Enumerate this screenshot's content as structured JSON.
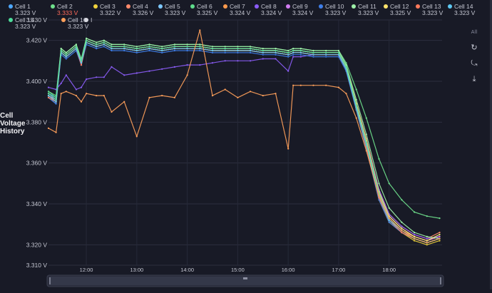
{
  "side_title": [
    "Cell",
    "Voltage",
    "History"
  ],
  "toolbar": {
    "collapse_label": "All",
    "icons": [
      "refresh-icon",
      "zoom-reset-icon",
      "download-icon"
    ]
  },
  "legend_items": [
    {
      "name": "Cell 1",
      "value": "3.323 V",
      "color": "#4ea8ff"
    },
    {
      "name": "Cell 2",
      "value": "3.333 V",
      "color": "#6fe08c",
      "value_color": "#ff6b5a"
    },
    {
      "name": "Cell 3",
      "value": "3.322 V",
      "color": "#f0d23c"
    },
    {
      "name": "Cell 4",
      "value": "3.326 V",
      "color": "#ff8a6b"
    },
    {
      "name": "Cell 5",
      "value": "3.323 V",
      "color": "#7ec8ff"
    },
    {
      "name": "Cell 6",
      "value": "3.325 V",
      "color": "#5fdc8c"
    },
    {
      "name": "Cell 7",
      "value": "3.324 V",
      "color": "#ff9a4d"
    },
    {
      "name": "Cell 8",
      "value": "3.324 V",
      "color": "#8b5cf6"
    },
    {
      "name": "Cell 9",
      "value": "3.324 V",
      "color": "#d07cf0"
    },
    {
      "name": "Cell 10",
      "value": "3.323 V",
      "color": "#3f7ee8"
    },
    {
      "name": "Cell 11",
      "value": "3.323 V",
      "color": "#9ef0a8"
    },
    {
      "name": "Cell 12",
      "value": "3.325 V",
      "color": "#ffe36b"
    },
    {
      "name": "Cell 13",
      "value": "3.323 V",
      "color": "#ff7a5c"
    },
    {
      "name": "Cell 14",
      "value": "3.323 V",
      "color": "#5ec8f2"
    },
    {
      "name": "Cell 15",
      "value": "3.323 V",
      "color": "#4ddc9a"
    },
    {
      "name": "Cell 16",
      "value": "3.323 V",
      "color": "#ff9f5a"
    },
    {
      "name": "I",
      "value": "",
      "color": "#d8d8e0"
    }
  ],
  "chart_data": {
    "type": "line",
    "ylabel": "",
    "ylim": [
      3.31,
      3.43
    ],
    "y_ticks": [
      "3.430 V",
      "3.420 V",
      "3.400 V",
      "3.380 V",
      "3.360 V",
      "3.340 V",
      "3.320 V",
      "3.310 V"
    ],
    "x_ticks": [
      "12:00",
      "13:00",
      "14:00",
      "15:00",
      "16:00",
      "17:00",
      "18:00"
    ],
    "x_unit": "hours (decimal)",
    "xlim": [
      11.25,
      19.05
    ],
    "x": [
      11.25,
      11.4,
      11.5,
      11.6,
      11.8,
      11.9,
      12.0,
      12.2,
      12.35,
      12.5,
      12.75,
      13.0,
      13.25,
      13.5,
      13.75,
      14.0,
      14.25,
      14.5,
      14.75,
      15.0,
      15.25,
      15.5,
      15.75,
      16.0,
      16.1,
      16.25,
      16.5,
      16.75,
      17.0,
      17.15,
      17.35,
      17.55,
      17.8,
      18.0,
      18.25,
      18.5,
      18.75,
      19.0
    ],
    "series": [
      {
        "name": "Cell 1",
        "color": "#4ea8ff",
        "values": [
          3.394,
          3.392,
          3.415,
          3.413,
          3.417,
          3.409,
          3.42,
          3.418,
          3.419,
          3.417,
          3.417,
          3.416,
          3.417,
          3.416,
          3.417,
          3.417,
          3.417,
          3.416,
          3.416,
          3.416,
          3.416,
          3.415,
          3.415,
          3.414,
          3.415,
          3.415,
          3.414,
          3.414,
          3.414,
          3.407,
          3.388,
          3.37,
          3.345,
          3.333,
          3.327,
          3.323,
          3.321,
          3.323
        ]
      },
      {
        "name": "Cell 2",
        "color": "#6fe08c",
        "values": [
          3.395,
          3.393,
          3.416,
          3.414,
          3.418,
          3.411,
          3.421,
          3.419,
          3.42,
          3.418,
          3.418,
          3.417,
          3.418,
          3.417,
          3.418,
          3.418,
          3.418,
          3.417,
          3.417,
          3.417,
          3.417,
          3.416,
          3.416,
          3.415,
          3.416,
          3.416,
          3.415,
          3.415,
          3.415,
          3.409,
          3.396,
          3.382,
          3.362,
          3.35,
          3.342,
          3.336,
          3.334,
          3.333
        ]
      },
      {
        "name": "Cell 3",
        "color": "#f0d23c",
        "values": [
          3.393,
          3.39,
          3.414,
          3.412,
          3.416,
          3.408,
          3.419,
          3.417,
          3.418,
          3.416,
          3.416,
          3.415,
          3.416,
          3.415,
          3.416,
          3.416,
          3.416,
          3.415,
          3.415,
          3.415,
          3.415,
          3.414,
          3.414,
          3.413,
          3.414,
          3.414,
          3.413,
          3.413,
          3.413,
          3.406,
          3.386,
          3.367,
          3.342,
          3.331,
          3.326,
          3.322,
          3.32,
          3.322
        ]
      },
      {
        "name": "Cell 4",
        "color": "#ff8a6b",
        "values": [
          3.394,
          3.391,
          3.415,
          3.413,
          3.417,
          3.41,
          3.42,
          3.418,
          3.419,
          3.417,
          3.417,
          3.416,
          3.417,
          3.416,
          3.417,
          3.417,
          3.417,
          3.416,
          3.416,
          3.416,
          3.416,
          3.415,
          3.415,
          3.414,
          3.415,
          3.415,
          3.414,
          3.414,
          3.414,
          3.407,
          3.389,
          3.372,
          3.347,
          3.335,
          3.329,
          3.325,
          3.323,
          3.326
        ]
      },
      {
        "name": "Cell 5",
        "color": "#7ec8ff",
        "values": [
          3.392,
          3.389,
          3.414,
          3.412,
          3.416,
          3.408,
          3.419,
          3.417,
          3.418,
          3.416,
          3.416,
          3.415,
          3.416,
          3.415,
          3.416,
          3.416,
          3.416,
          3.415,
          3.415,
          3.415,
          3.415,
          3.414,
          3.414,
          3.413,
          3.414,
          3.414,
          3.413,
          3.413,
          3.413,
          3.406,
          3.387,
          3.368,
          3.343,
          3.332,
          3.326,
          3.323,
          3.321,
          3.323
        ]
      },
      {
        "name": "Cell 6",
        "color": "#5fdc8c",
        "values": [
          3.395,
          3.392,
          3.415,
          3.413,
          3.417,
          3.41,
          3.42,
          3.418,
          3.419,
          3.417,
          3.417,
          3.416,
          3.417,
          3.416,
          3.417,
          3.417,
          3.417,
          3.416,
          3.416,
          3.416,
          3.416,
          3.415,
          3.415,
          3.414,
          3.415,
          3.415,
          3.414,
          3.414,
          3.414,
          3.407,
          3.389,
          3.371,
          3.346,
          3.334,
          3.328,
          3.324,
          3.322,
          3.325
        ]
      },
      {
        "name": "Cell 7",
        "color": "#ff9a4d",
        "values": [
          3.393,
          3.39,
          3.414,
          3.412,
          3.416,
          3.409,
          3.419,
          3.417,
          3.418,
          3.416,
          3.416,
          3.415,
          3.416,
          3.415,
          3.416,
          3.416,
          3.416,
          3.415,
          3.415,
          3.415,
          3.415,
          3.414,
          3.414,
          3.413,
          3.414,
          3.414,
          3.413,
          3.413,
          3.413,
          3.406,
          3.388,
          3.37,
          3.345,
          3.333,
          3.327,
          3.324,
          3.322,
          3.324
        ]
      },
      {
        "name": "Cell 8",
        "color": "#8b5cf6",
        "values": [
          3.397,
          3.396,
          3.399,
          3.403,
          3.396,
          3.397,
          3.401,
          3.402,
          3.402,
          3.407,
          3.403,
          3.404,
          3.405,
          3.406,
          3.407,
          3.408,
          3.408,
          3.409,
          3.41,
          3.41,
          3.41,
          3.411,
          3.411,
          3.405,
          3.412,
          3.412,
          3.413,
          3.413,
          3.413,
          3.406,
          3.389,
          3.371,
          3.347,
          3.335,
          3.329,
          3.325,
          3.323,
          3.324
        ]
      },
      {
        "name": "Cell 9",
        "color": "#d07cf0",
        "values": [
          3.393,
          3.391,
          3.415,
          3.413,
          3.417,
          3.41,
          3.42,
          3.418,
          3.419,
          3.417,
          3.417,
          3.416,
          3.417,
          3.416,
          3.417,
          3.417,
          3.417,
          3.416,
          3.416,
          3.416,
          3.416,
          3.415,
          3.415,
          3.414,
          3.415,
          3.415,
          3.414,
          3.414,
          3.414,
          3.407,
          3.388,
          3.37,
          3.345,
          3.334,
          3.328,
          3.324,
          3.322,
          3.324
        ]
      },
      {
        "name": "Cell 10",
        "color": "#3f7ee8",
        "values": [
          3.392,
          3.389,
          3.413,
          3.411,
          3.415,
          3.408,
          3.418,
          3.416,
          3.417,
          3.415,
          3.415,
          3.414,
          3.415,
          3.414,
          3.415,
          3.415,
          3.415,
          3.414,
          3.414,
          3.414,
          3.414,
          3.413,
          3.413,
          3.412,
          3.413,
          3.413,
          3.412,
          3.412,
          3.412,
          3.405,
          3.386,
          3.367,
          3.342,
          3.331,
          3.326,
          3.323,
          3.321,
          3.323
        ]
      },
      {
        "name": "Cell 11",
        "color": "#9ef0a8",
        "values": [
          3.394,
          3.391,
          3.416,
          3.414,
          3.418,
          3.41,
          3.421,
          3.419,
          3.42,
          3.418,
          3.418,
          3.417,
          3.418,
          3.417,
          3.418,
          3.418,
          3.418,
          3.417,
          3.417,
          3.417,
          3.417,
          3.416,
          3.416,
          3.415,
          3.416,
          3.416,
          3.415,
          3.415,
          3.415,
          3.408,
          3.391,
          3.374,
          3.35,
          3.338,
          3.331,
          3.326,
          3.324,
          3.323
        ]
      },
      {
        "name": "Cell 12",
        "color": "#ffe36b",
        "values": [
          3.393,
          3.39,
          3.415,
          3.413,
          3.417,
          3.409,
          3.42,
          3.418,
          3.419,
          3.417,
          3.417,
          3.416,
          3.417,
          3.416,
          3.417,
          3.417,
          3.417,
          3.416,
          3.416,
          3.416,
          3.416,
          3.415,
          3.415,
          3.414,
          3.415,
          3.415,
          3.414,
          3.414,
          3.414,
          3.407,
          3.389,
          3.371,
          3.346,
          3.334,
          3.328,
          3.324,
          3.322,
          3.325
        ]
      },
      {
        "name": "Cell 13",
        "color": "#ff7a5c",
        "values": [
          3.392,
          3.39,
          3.414,
          3.412,
          3.416,
          3.408,
          3.419,
          3.417,
          3.418,
          3.416,
          3.416,
          3.415,
          3.416,
          3.415,
          3.416,
          3.416,
          3.416,
          3.415,
          3.415,
          3.415,
          3.415,
          3.414,
          3.414,
          3.413,
          3.414,
          3.414,
          3.413,
          3.413,
          3.413,
          3.406,
          3.387,
          3.368,
          3.343,
          3.332,
          3.326,
          3.323,
          3.321,
          3.323
        ]
      },
      {
        "name": "Cell 14",
        "color": "#5ec8f2",
        "values": [
          3.393,
          3.39,
          3.414,
          3.412,
          3.416,
          3.409,
          3.419,
          3.417,
          3.418,
          3.416,
          3.416,
          3.415,
          3.416,
          3.415,
          3.416,
          3.416,
          3.416,
          3.415,
          3.415,
          3.415,
          3.415,
          3.414,
          3.414,
          3.413,
          3.414,
          3.414,
          3.413,
          3.413,
          3.413,
          3.406,
          3.387,
          3.369,
          3.344,
          3.332,
          3.327,
          3.323,
          3.321,
          3.323
        ]
      },
      {
        "name": "Cell 15",
        "color": "#4ddc9a",
        "values": [
          3.394,
          3.391,
          3.415,
          3.413,
          3.417,
          3.41,
          3.42,
          3.418,
          3.419,
          3.417,
          3.417,
          3.416,
          3.417,
          3.416,
          3.417,
          3.417,
          3.417,
          3.416,
          3.416,
          3.416,
          3.416,
          3.415,
          3.415,
          3.414,
          3.415,
          3.415,
          3.414,
          3.414,
          3.414,
          3.407,
          3.388,
          3.37,
          3.345,
          3.333,
          3.327,
          3.323,
          3.321,
          3.323
        ]
      },
      {
        "name": "Cell 16",
        "color": "#ff9f5a",
        "values": [
          3.377,
          3.375,
          3.394,
          3.395,
          3.393,
          3.39,
          3.394,
          3.393,
          3.393,
          3.385,
          3.39,
          3.373,
          3.392,
          3.393,
          3.392,
          3.403,
          3.425,
          3.393,
          3.396,
          3.392,
          3.395,
          3.393,
          3.394,
          3.367,
          3.398,
          3.398,
          3.398,
          3.398,
          3.397,
          3.394,
          3.382,
          3.366,
          3.344,
          3.333,
          3.327,
          3.323,
          3.321,
          3.323
        ]
      }
    ]
  }
}
